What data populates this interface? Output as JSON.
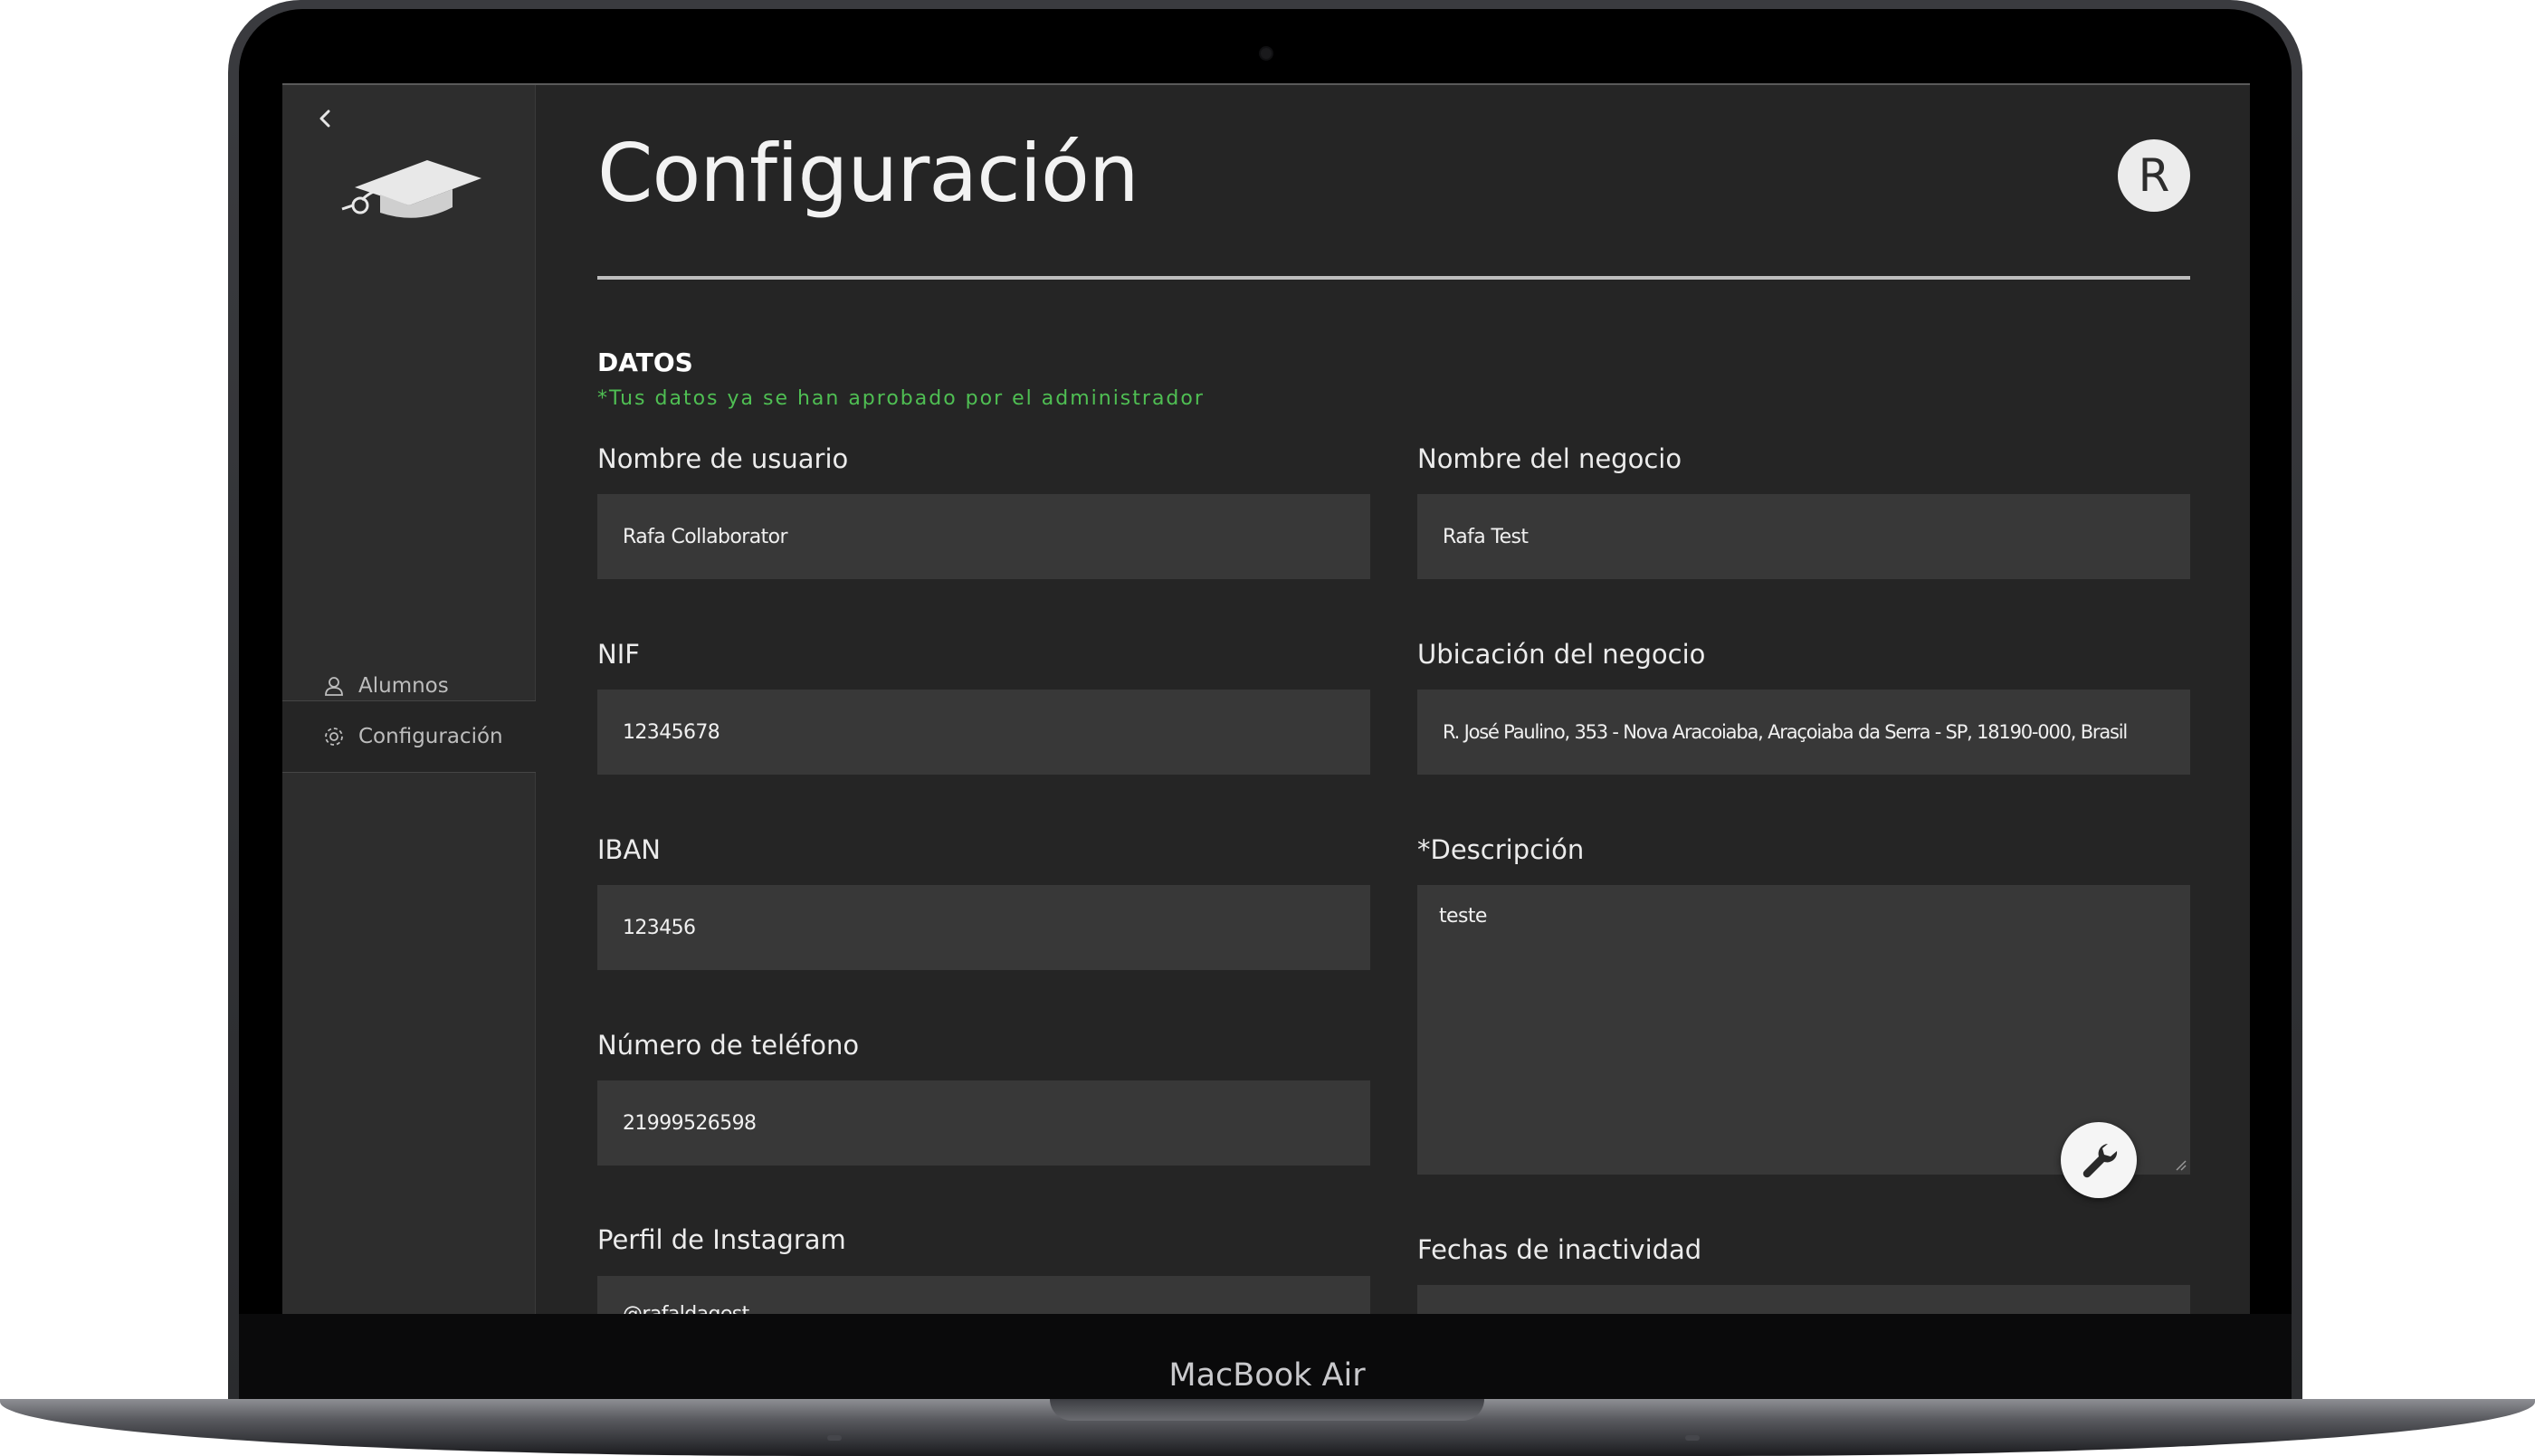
{
  "device": {
    "brand_label": "MacBook Air"
  },
  "sidebar": {
    "items": [
      {
        "label": "Alumnos",
        "icon": "user-icon"
      },
      {
        "label": "Configuración",
        "icon": "gear-icon",
        "active": true
      }
    ]
  },
  "header": {
    "title": "Configuración",
    "avatar_initial": "R"
  },
  "form": {
    "section_title": "DATOS",
    "approval_note": "*Tus datos ya se han aprobado por el administrador",
    "fields": {
      "username": {
        "label": "Nombre de usuario",
        "value": "Rafa Collaborator"
      },
      "business_name": {
        "label": "Nombre del negocio",
        "value": "Rafa Test"
      },
      "nif": {
        "label": "NIF",
        "value": "12345678"
      },
      "business_location": {
        "label": "Ubicación del negocio",
        "value": "R. José Paulino, 353 - Nova Aracoiaba, Araçoiaba da Serra - SP, 18190-000, Brasil"
      },
      "iban": {
        "label": "IBAN",
        "value": "123456"
      },
      "description": {
        "label": "*Descripción",
        "value": "teste"
      },
      "phone": {
        "label": "Número de teléfono",
        "value": "21999526598"
      },
      "instagram": {
        "label": "Perfil de Instagram",
        "value": "@rafaldagest"
      },
      "inactivity_dates": {
        "label": "Fechas de inactividad",
        "value": ""
      }
    }
  },
  "colors": {
    "screen_bg": "#252525",
    "sidebar_bg": "#2d2d2d",
    "input_bg": "#383838",
    "approval_green": "#4fbf53"
  }
}
